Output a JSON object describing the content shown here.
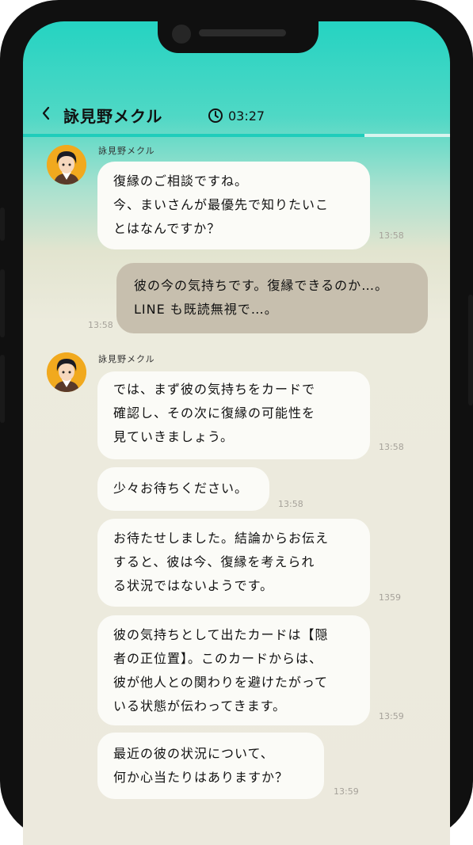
{
  "header": {
    "back_icon": "chevron-left-icon",
    "title": "詠見野メクル",
    "timer_icon": "clock-icon",
    "timer": "03:27",
    "progress": 0.8
  },
  "colors": {
    "accent": "#1fcdbb",
    "user_bubble": "#c7bfae",
    "bot_bubble": "#fbfbf7"
  },
  "messages": [
    {
      "sender": "詠見野メクル",
      "text": "復縁のご相談ですね。\n今、まいさんが最優先で知りたいこ\nとはなんですか？",
      "time": "13:58"
    },
    {
      "sender": "me",
      "text": "彼の今の気持ちです。復縁できるのか…。\nLINE も既読無視で…。",
      "time": "13:58"
    },
    {
      "sender": "詠見野メクル",
      "text": "では、まず彼の気持ちをカードで\n確認し、その次に復縁の可能性を\n見ていきましょう。",
      "time": "13:58"
    },
    {
      "sender": "詠見野メクル",
      "text": "少々お待ちください。",
      "time": "13:58"
    },
    {
      "sender": "詠見野メクル",
      "text": "お待たせしました。結論からお伝え\nすると、彼は今、復縁を考えられ\nる状況ではないようです。",
      "time": "1359"
    },
    {
      "sender": "詠見野メクル",
      "text": "彼の気持ちとして出たカードは【隠\n者の正位置】。このカードからは、\n彼が他人との関わりを避けたがって\nいる状態が伝わってきます。",
      "time": "13:59"
    },
    {
      "sender": "詠見野メクル",
      "text": "最近の彼の状況について、\n何か心当たりはありますか？",
      "time": "13:59"
    }
  ]
}
